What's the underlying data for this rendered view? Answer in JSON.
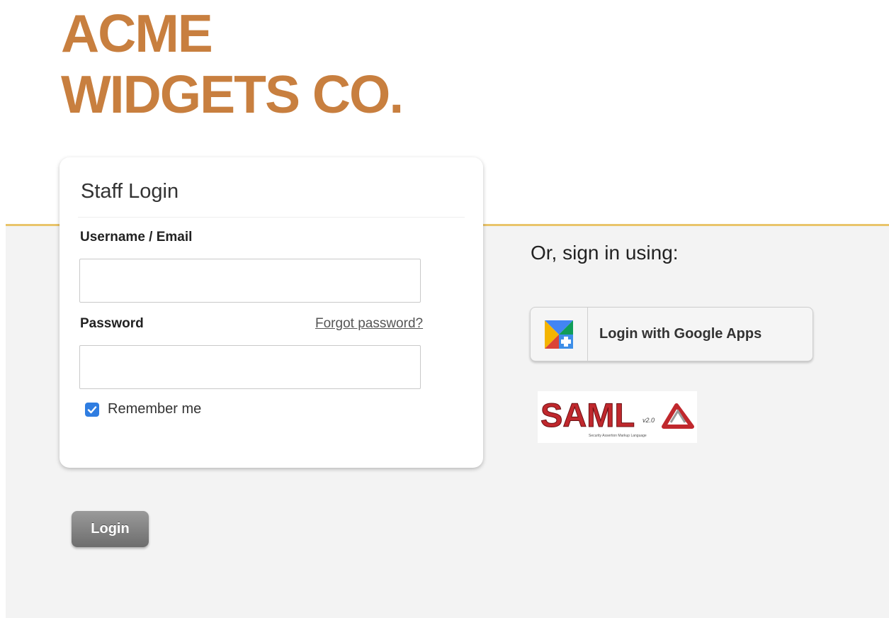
{
  "brand": {
    "line1": "ACME",
    "line2": "WIDGETS CO.",
    "color": "#c87f3f"
  },
  "login_card": {
    "title": "Staff Login",
    "username_label": "Username / Email",
    "username_value": "",
    "password_label": "Password",
    "password_value": "",
    "forgot_link": "Forgot password?",
    "remember_label": "Remember me",
    "remember_checked": true
  },
  "login_button": "Login",
  "alt_signin": {
    "heading": "Or, sign in using:",
    "google_button": "Login with Google Apps",
    "google_icon": "google-apps-icon",
    "saml_logo": {
      "text": "SAML",
      "version": "v2.0",
      "tagline": "Security Assertion Markup Language"
    }
  },
  "colors": {
    "accent_line": "#e9c46a",
    "checkbox": "#2f7de1",
    "saml_red": "#c0282d"
  }
}
